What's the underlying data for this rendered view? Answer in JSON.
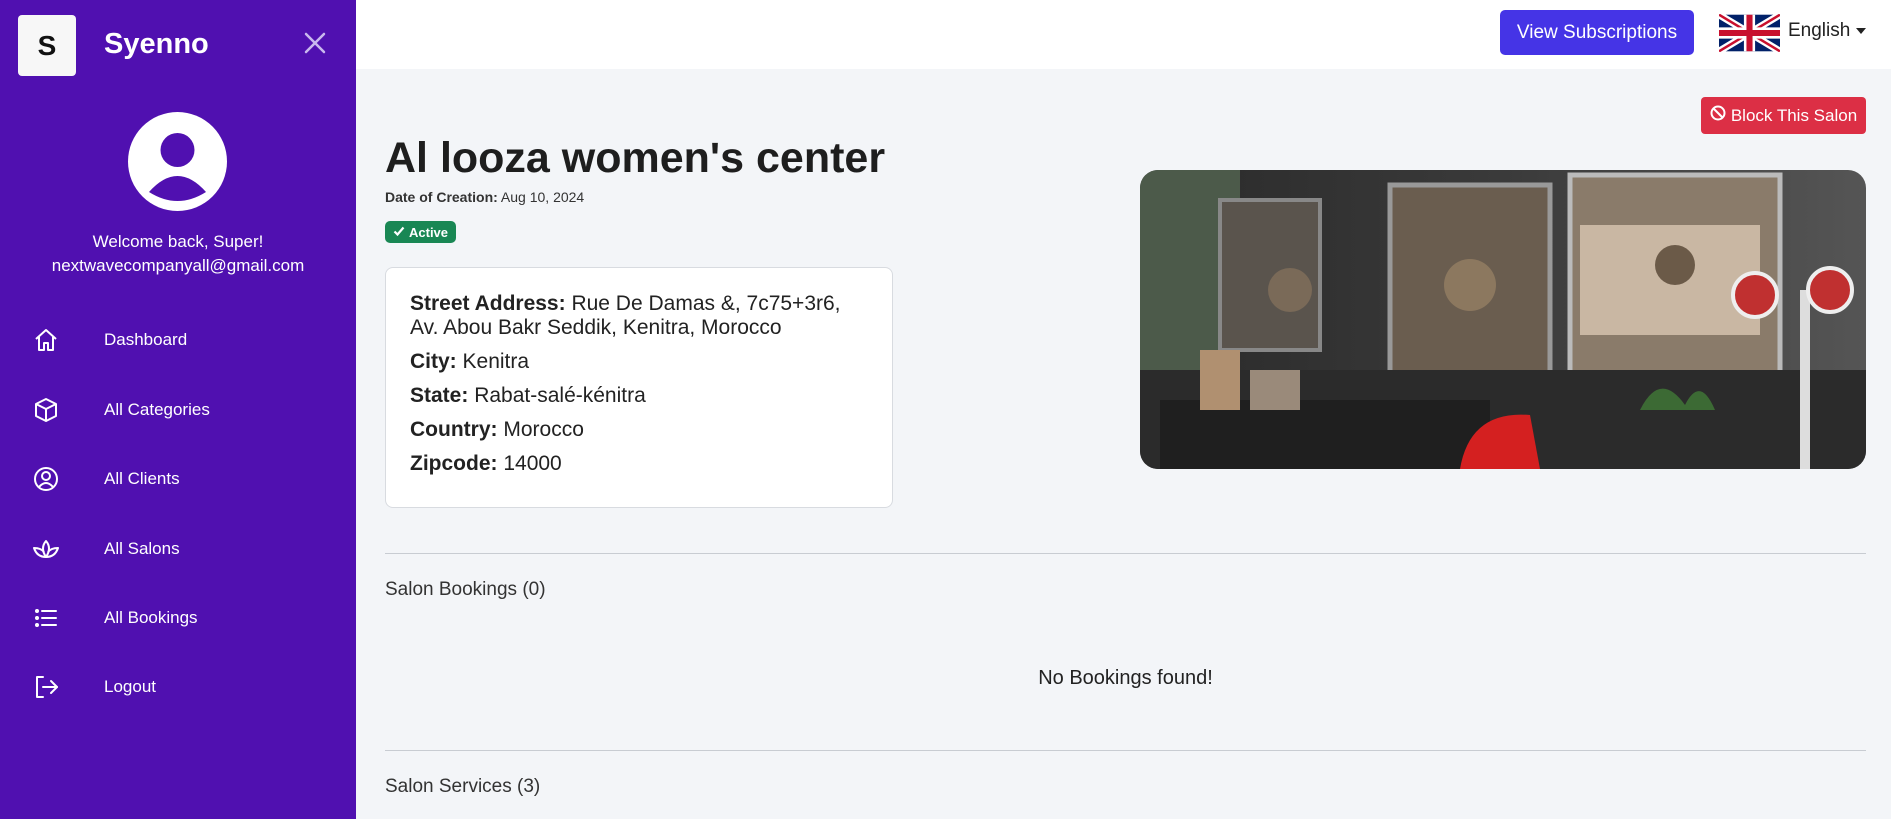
{
  "sidebar": {
    "logo_letter": "S",
    "brand": "Syenno",
    "welcome": "Welcome back, Super!",
    "email": "nextwavecompanyall@gmail.com",
    "items": [
      {
        "label": "Dashboard",
        "icon": "home-icon"
      },
      {
        "label": "All Categories",
        "icon": "box-icon"
      },
      {
        "label": "All Clients",
        "icon": "user-circle-icon"
      },
      {
        "label": "All Salons",
        "icon": "lotus-icon"
      },
      {
        "label": "All Bookings",
        "icon": "list-icon"
      },
      {
        "label": "Logout",
        "icon": "logout-icon"
      }
    ]
  },
  "topbar": {
    "subscriptions_label": "View Subscriptions",
    "language": "English",
    "flag": "uk-flag-icon"
  },
  "salon": {
    "block_label": "Block This Salon",
    "name": "Al looza women's center",
    "creation_label": "Date of Creation:",
    "creation_date": "Aug 10, 2024",
    "status": "Active",
    "address": {
      "street_label": "Street Address:",
      "street_value": "Rue De Damas &, 7c75+3r6,",
      "street_value_line2": "Av. Abou Bakr Seddik, Kenitra, Morocco",
      "city_label": "City:",
      "city_value": "Kenitra",
      "state_label": "State:",
      "state_value": "Rabat-salé-kénitra",
      "country_label": "Country:",
      "country_value": "Morocco",
      "zip_label": "Zipcode:",
      "zip_value": "14000"
    }
  },
  "bookings": {
    "title": "Salon Bookings (0)",
    "empty": "No Bookings found!"
  },
  "services": {
    "title": "Salon Services (3)"
  },
  "colors": {
    "sidebar_bg": "#5010b0",
    "primary_button": "#4534e6",
    "danger_button": "#dc2f45",
    "success_badge": "#198754"
  }
}
